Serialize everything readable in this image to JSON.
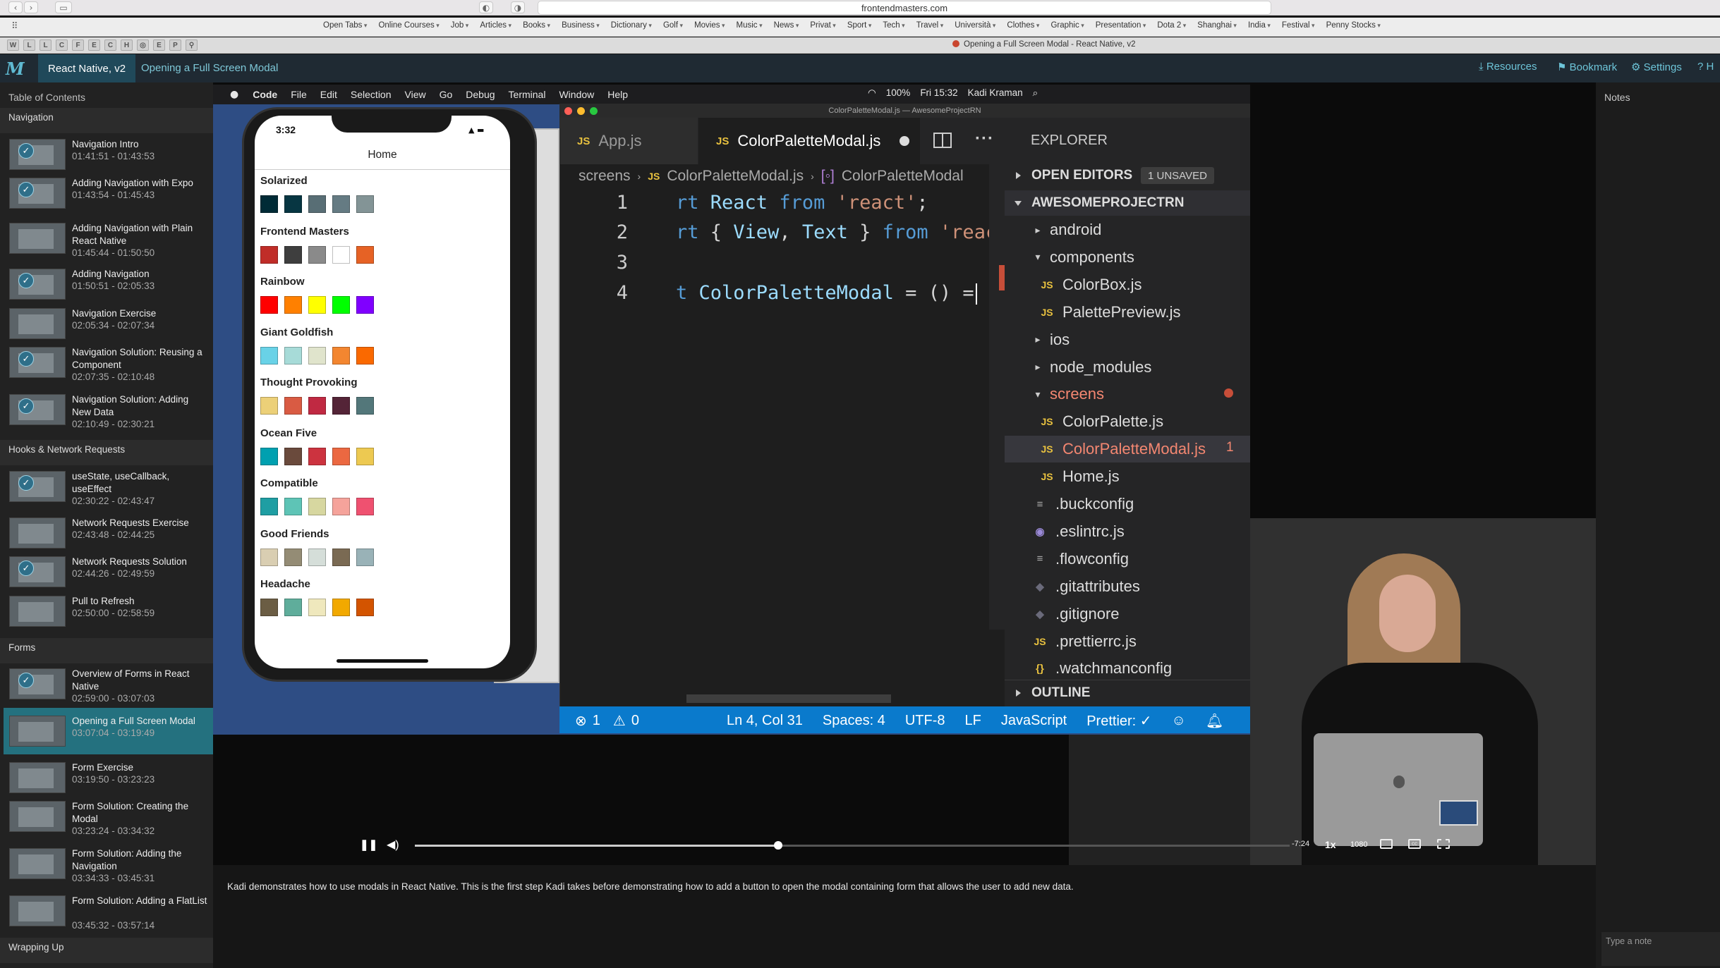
{
  "browser": {
    "url": "frontendmasters.com",
    "tab_title": "Opening a Full Screen Modal - React Native, v2",
    "favorites": [
      "Open Tabs",
      "Online Courses",
      "Job",
      "Articles",
      "Books",
      "Business",
      "Dictionary",
      "Golf",
      "Movies",
      "Music",
      "News",
      "Privat",
      "Sport",
      "Tech",
      "Travel",
      "Università",
      "Clothes",
      "Graphic",
      "Presentation",
      "Dota 2",
      "Shanghai",
      "India",
      "Festival",
      "Penny Stocks"
    ],
    "extensions": [
      "W",
      "L",
      "L",
      "C",
      "F",
      "E",
      "C",
      "H",
      "◎",
      "E",
      "P",
      "⚲"
    ]
  },
  "header": {
    "logo": "M",
    "course": "React Native, v2",
    "lesson": "Opening a Full Screen Modal",
    "links": {
      "resources": "Resources",
      "bookmark": "Bookmark",
      "settings": "Settings",
      "help": "H"
    }
  },
  "sidebar": {
    "title": "Table of Contents",
    "sections": [
      {
        "name": "Navigation",
        "lessons": [
          {
            "title": "Navigation Intro",
            "time": "01:41:51 - 01:43:53",
            "done": true
          },
          {
            "title": "Adding Navigation with Expo",
            "time": "01:43:54 - 01:45:43",
            "done": true
          },
          {
            "title": "Adding Navigation with Plain React Native",
            "time": "01:45:44 - 01:50:50",
            "done": false
          },
          {
            "title": "Adding Navigation",
            "time": "01:50:51 - 02:05:33",
            "done": true
          },
          {
            "title": "Navigation Exercise",
            "time": "02:05:34 - 02:07:34",
            "done": false
          },
          {
            "title": "Navigation Solution: Reusing a Component",
            "time": "02:07:35 - 02:10:48",
            "done": true
          },
          {
            "title": "Navigation Solution: Adding New Data",
            "time": "02:10:49 - 02:30:21",
            "done": true
          }
        ]
      },
      {
        "name": "Hooks & Network Requests",
        "lessons": [
          {
            "title": "useState, useCallback, useEffect",
            "time": "02:30:22 - 02:43:47",
            "done": true
          },
          {
            "title": "Network Requests Exercise",
            "time": "02:43:48 - 02:44:25",
            "done": false
          },
          {
            "title": "Network Requests Solution",
            "time": "02:44:26 - 02:49:59",
            "done": true
          },
          {
            "title": "Pull to Refresh",
            "time": "02:50:00 - 02:58:59",
            "done": false
          }
        ]
      },
      {
        "name": "Forms",
        "lessons": [
          {
            "title": "Overview of Forms in React Native",
            "time": "02:59:00 - 03:07:03",
            "done": true
          },
          {
            "title": "Opening a Full Screen Modal",
            "time": "03:07:04 - 03:19:49",
            "done": false,
            "active": true
          },
          {
            "title": "Form Exercise",
            "time": "03:19:50 - 03:23:23",
            "done": false
          },
          {
            "title": "Form Solution: Creating the Modal",
            "time": "03:23:24 - 03:34:32",
            "done": false
          },
          {
            "title": "Form Solution: Adding the Navigation",
            "time": "03:34:33 - 03:45:31",
            "done": false
          },
          {
            "title": "Form Solution: Adding a FlatList",
            "time": "03:45:32 - 03:57:14",
            "done": false
          }
        ]
      },
      {
        "name": "Wrapping Up",
        "lessons": []
      }
    ]
  },
  "mac_menubar": {
    "apple": "",
    "items": [
      "Code",
      "File",
      "Edit",
      "Selection",
      "View",
      "Go",
      "Debug",
      "Terminal",
      "Window",
      "Help"
    ],
    "battery": "100%",
    "clock": "Fri 15:32",
    "user": "Kadi Kraman"
  },
  "phone": {
    "time": "3:32",
    "title": "Home",
    "palettes": [
      {
        "name": "Solarized",
        "colors": [
          "#002b36",
          "#073642",
          "#586e75",
          "#657b83",
          "#839496"
        ]
      },
      {
        "name": "Frontend Masters",
        "colors": [
          "#c02d28",
          "#3e3e3e",
          "#8a8a8a",
          "#ffffff",
          "#e66225"
        ]
      },
      {
        "name": "Rainbow",
        "colors": [
          "#ff0000",
          "#ff8000",
          "#ffff00",
          "#00ff00",
          "#8000ff"
        ]
      },
      {
        "name": "Giant Goldfish",
        "colors": [
          "#69d2e7",
          "#a7dbd8",
          "#e0e4cc",
          "#f38630",
          "#fa6900"
        ]
      },
      {
        "name": "Thought Provoking",
        "colors": [
          "#ecd078",
          "#d95b43",
          "#c02942",
          "#542437",
          "#53777a"
        ]
      },
      {
        "name": "Ocean Five",
        "colors": [
          "#00a0b0",
          "#6a4a3c",
          "#cc333f",
          "#eb6841",
          "#edc951"
        ]
      },
      {
        "name": "Compatible",
        "colors": [
          "#1f9ea3",
          "#5ec4b6",
          "#d7d7a0",
          "#f5a39b",
          "#ef5170"
        ]
      },
      {
        "name": "Good Friends",
        "colors": [
          "#d9ceb2",
          "#948c75",
          "#d5ded9",
          "#7a6a53",
          "#99b2b7"
        ]
      },
      {
        "name": "Headache",
        "colors": [
          "#6b5d44",
          "#5fad9b",
          "#efe8bd",
          "#f2a900",
          "#d35400"
        ]
      }
    ]
  },
  "vscode": {
    "window_title": "ColorPaletteModal.js — AwesomeProjectRN",
    "tabs": [
      {
        "label": "App.js",
        "lang": "JS"
      },
      {
        "label": "ColorPaletteModal.js",
        "lang": "JS"
      }
    ],
    "breadcrumb": [
      "screens",
      "ColorPaletteModal.js",
      "ColorPaletteModal"
    ],
    "code": [
      {
        "n": "1",
        "parts": [
          {
            "t": "rt ",
            "c": "kw"
          },
          {
            "t": "React ",
            "c": "id"
          },
          {
            "t": "from ",
            "c": "kw"
          },
          {
            "t": "'react'",
            "c": "str"
          },
          {
            "t": ";",
            "c": "pl"
          }
        ]
      },
      {
        "n": "2",
        "parts": [
          {
            "t": "rt ",
            "c": "kw"
          },
          {
            "t": "{ ",
            "c": "pl"
          },
          {
            "t": "View",
            "c": "id"
          },
          {
            "t": ", ",
            "c": "pl"
          },
          {
            "t": "Text ",
            "c": "id"
          },
          {
            "t": "} ",
            "c": "pl"
          },
          {
            "t": "from ",
            "c": "kw"
          },
          {
            "t": "'react",
            "c": "str"
          }
        ]
      },
      {
        "n": "3",
        "parts": []
      },
      {
        "n": "4",
        "parts": [
          {
            "t": "t ",
            "c": "kw"
          },
          {
            "t": "ColorPaletteModal ",
            "c": "id"
          },
          {
            "t": "= () =",
            "c": "pl"
          }
        ]
      }
    ],
    "explorer": {
      "title": "EXPLORER",
      "open_editors": "OPEN EDITORS",
      "unsaved": "1 UNSAVED",
      "project": "AWESOMEPROJECTRN",
      "outline": "OUTLINE",
      "tree": [
        {
          "label": "android",
          "kind": "folder",
          "indent": 0,
          "open": false
        },
        {
          "label": "components",
          "kind": "folder",
          "indent": 0,
          "open": true
        },
        {
          "label": "ColorBox.js",
          "kind": "js",
          "indent": 1
        },
        {
          "label": "PalettePreview.js",
          "kind": "js",
          "indent": 1
        },
        {
          "label": "ios",
          "kind": "folder",
          "indent": 0,
          "open": false
        },
        {
          "label": "node_modules",
          "kind": "folder",
          "indent": 0,
          "open": false
        },
        {
          "label": "screens",
          "kind": "folder",
          "indent": 0,
          "open": true,
          "error": true
        },
        {
          "label": "ColorPalette.js",
          "kind": "js",
          "indent": 1
        },
        {
          "label": "ColorPaletteModal.js",
          "kind": "js",
          "indent": 1,
          "selected": true,
          "error": true
        },
        {
          "label": "Home.js",
          "kind": "js",
          "indent": 1
        },
        {
          "label": ".buckconfig",
          "kind": "text",
          "indent": 0
        },
        {
          "label": ".eslintrc.js",
          "kind": "eslint",
          "indent": 0
        },
        {
          "label": ".flowconfig",
          "kind": "text",
          "indent": 0
        },
        {
          "label": ".gitattributes",
          "kind": "git",
          "indent": 0
        },
        {
          "label": ".gitignore",
          "kind": "git",
          "indent": 0
        },
        {
          "label": ".prettierrc.js",
          "kind": "js",
          "indent": 0
        },
        {
          "label": ".watchmanconfig",
          "kind": "json",
          "indent": 0
        }
      ],
      "selected_badge": "1"
    },
    "status": {
      "errors": "1",
      "warnings": "0",
      "position": "Ln 4, Col 31",
      "spaces": "Spaces: 4",
      "encoding": "UTF-8",
      "eol": "LF",
      "language": "JavaScript",
      "prettier": "Prettier: ✓"
    }
  },
  "player": {
    "remaining": "-7:24",
    "speed": "1x",
    "quality": "1080",
    "progress": 0.415
  },
  "description": "Kadi demonstrates how to use modals in React Native. This is the first step Kadi takes before demonstrating how to add a button to open the modal containing form that allows the user to add new data.",
  "notes": {
    "title": "Notes",
    "placeholder": "Type a note"
  }
}
